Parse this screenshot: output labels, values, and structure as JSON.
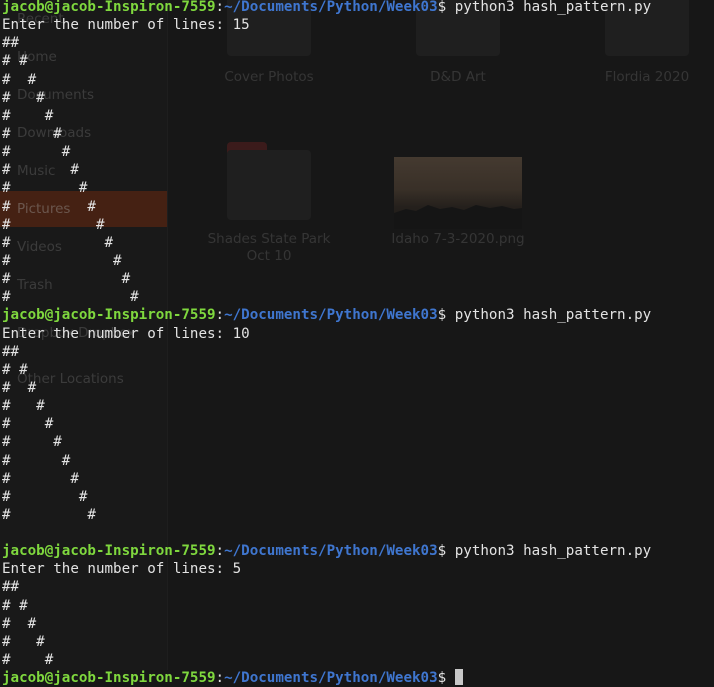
{
  "file_manager": {
    "sidebar": [
      "Recent",
      "Home",
      "Documents",
      "Downloads",
      "Music",
      "Pictures",
      "Videos",
      "Trash",
      "Dropbox Dropbox",
      "Other Locations"
    ],
    "active_item": "Pictures",
    "tiles": [
      {
        "label": "Cover Photos"
      },
      {
        "label": "D&D Art"
      },
      {
        "label": "Flordia 2020"
      },
      {
        "label": "Shades State Park Oct 10"
      },
      {
        "label": "Idaho 7-3-2020.png"
      }
    ]
  },
  "terminal": {
    "user_host": "jacob@jacob-Inspiron-7559",
    "path": "~/Documents/Python/Week03",
    "command": "python3 hash_pattern.py",
    "prompt_text": "Enter the number of lines: ",
    "runs": [
      {
        "input": "15",
        "pattern": [
          "##",
          "# #",
          "#  #",
          "#   #",
          "#    #",
          "#     #",
          "#      #",
          "#       #",
          "#        #",
          "#         #",
          "#          #",
          "#           #",
          "#            #",
          "#             #",
          "#              #"
        ]
      },
      {
        "input": "10",
        "pattern": [
          "##",
          "# #",
          "#  #",
          "#   #",
          "#    #",
          "#     #",
          "#      #",
          "#       #",
          "#        #",
          "#         #"
        ]
      },
      {
        "input": "5",
        "pattern": [
          "##",
          "# #",
          "#  #",
          "#   #",
          "#    #"
        ]
      }
    ]
  }
}
